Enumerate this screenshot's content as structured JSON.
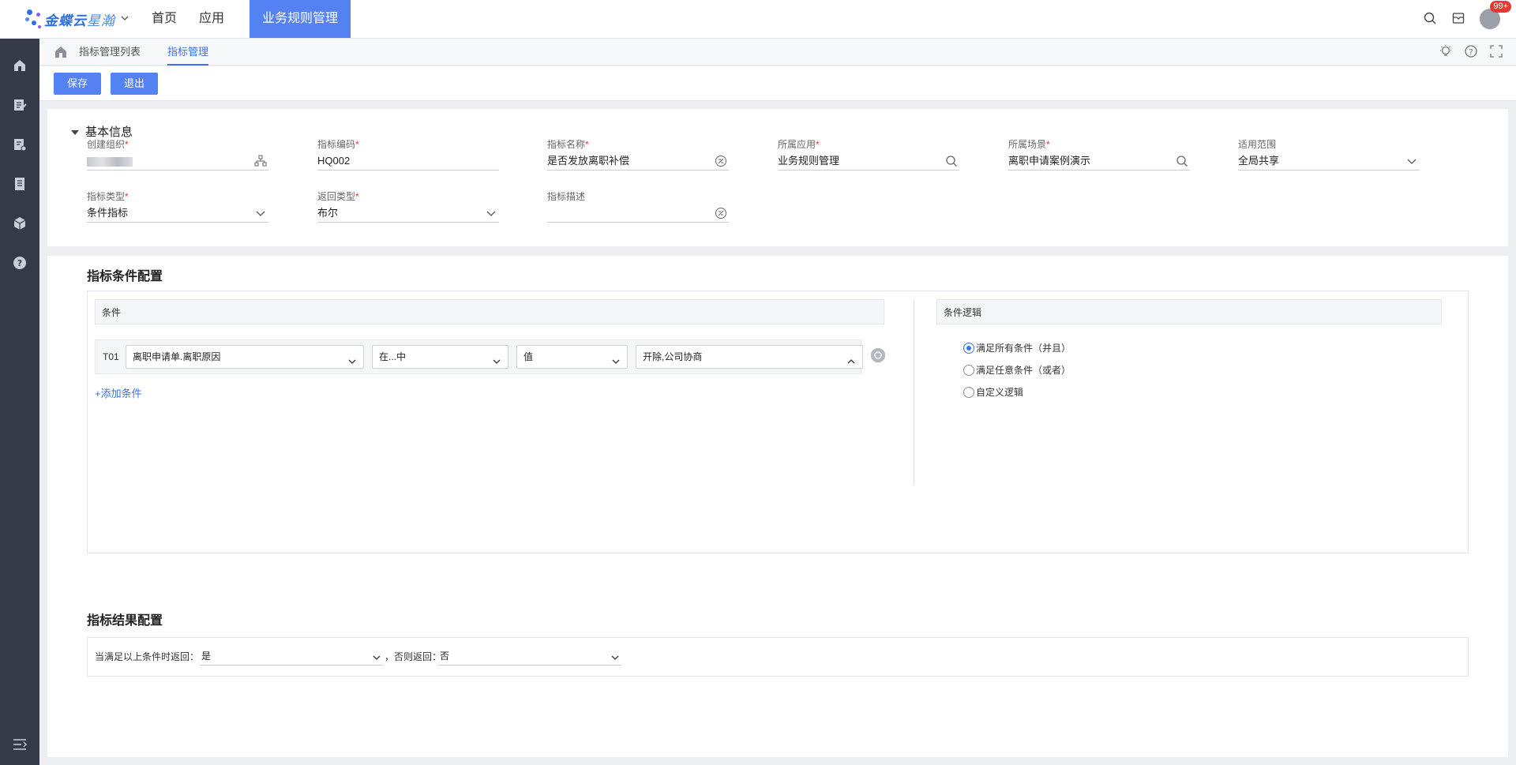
{
  "app": {
    "logo_main": "金蝶云",
    "logo_sub": "星瀚",
    "nav": [
      "首页",
      "应用"
    ],
    "active_app": "业务规则管理",
    "notification_count": "99+"
  },
  "tabs": [
    "指标管理列表",
    "指标管理"
  ],
  "toolbar": {
    "save_label": "保存",
    "exit_label": "退出"
  },
  "basic_info": {
    "title": "基本信息",
    "fields": {
      "org": {
        "label": "创建组织",
        "value": ""
      },
      "code": {
        "label": "指标编码",
        "value": "HQ002"
      },
      "name": {
        "label": "指标名称",
        "value": "是否发放离职补偿"
      },
      "app": {
        "label": "所属应用",
        "value": "业务规则管理"
      },
      "scene": {
        "label": "所属场景",
        "value": "离职申请案例演示"
      },
      "scope": {
        "label": "适用范围",
        "value": "全局共享"
      },
      "type": {
        "label": "指标类型",
        "value": "条件指标"
      },
      "return_type": {
        "label": "返回类型",
        "value": "布尔"
      },
      "desc": {
        "label": "指标描述",
        "value": ""
      }
    }
  },
  "conditions": {
    "title": "指标条件配置",
    "col_conditions": "条件",
    "col_logic": "条件逻辑",
    "rows": [
      {
        "id": "T01",
        "field": "离职申请单.离职原因",
        "operator": "在...中",
        "value_type": "值",
        "value": "开除,公司协商"
      }
    ],
    "add_label": "+添加条件",
    "logic_options": [
      {
        "label": "满足所有条件（并且）",
        "selected": true
      },
      {
        "label": "满足任意条件（或者）",
        "selected": false
      },
      {
        "label": "自定义逻辑",
        "selected": false
      }
    ]
  },
  "result": {
    "title": "指标结果配置",
    "when_label": "当满足以上条件时返回：",
    "when_value": "是",
    "else_label": "，否则返回：",
    "else_value": "否"
  }
}
